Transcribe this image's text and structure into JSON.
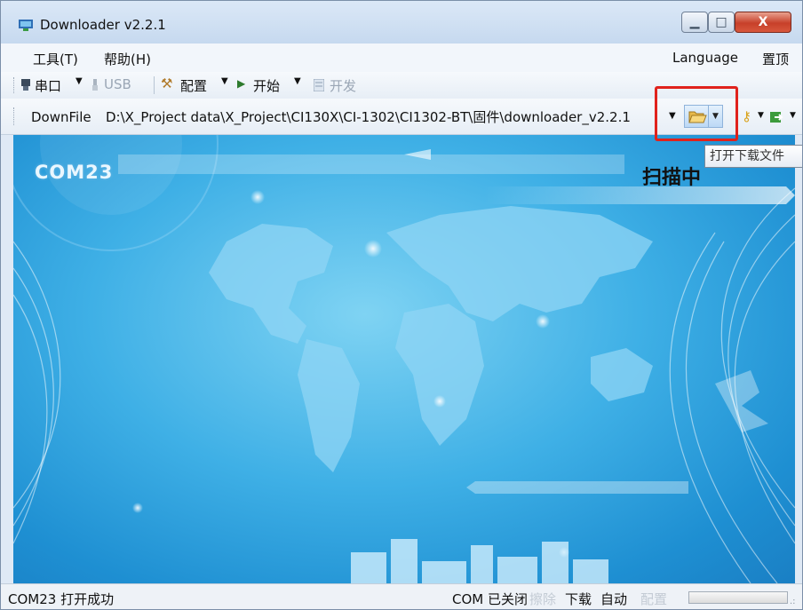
{
  "window": {
    "title": "Downloader v2.2.1",
    "app_icon": "downloader-app-icon"
  },
  "menu": {
    "tools": "工具(T)",
    "help": "帮助(H)",
    "language": "Language",
    "pin_top": "置顶"
  },
  "toolbar": {
    "serial": "串口",
    "usb": "USB",
    "config": "配置",
    "start": "开始",
    "develop": "开发",
    "downfile_label": "DownFile",
    "path_value": "D:\\X_Project data\\X_Project\\CI130X\\CI-1302\\CI1302-BT\\固件\\downloader_v2.2.1",
    "open_tooltip": "打开下载文件",
    "icons": [
      "serial-port-icon",
      "usb-plug-icon",
      "tools-icon",
      "play-icon",
      "document-icon",
      "folder-open-icon",
      "key-icon",
      "export-icon"
    ]
  },
  "canvas": {
    "com_port": "COM23",
    "scan_status": "扫描中"
  },
  "status": {
    "left_text": "COM23 打开成功",
    "com_state": "COM 已关闭",
    "erase": "擦除",
    "download": "下载",
    "auto": "自动",
    "config": "配置",
    "progress": 0
  },
  "colors": {
    "highlight": "#e0221c",
    "canvas_blue": "#3fb0e6"
  }
}
